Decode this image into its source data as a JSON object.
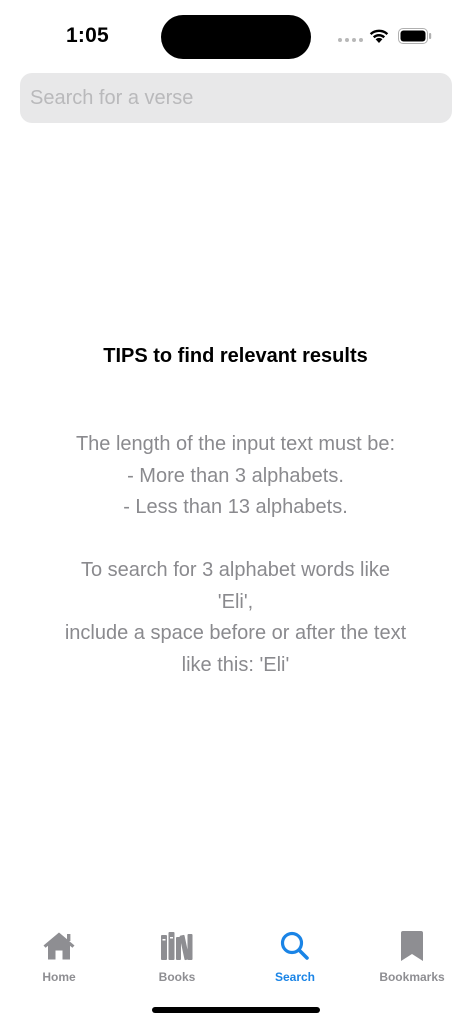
{
  "status_bar": {
    "time": "1:05"
  },
  "search": {
    "placeholder": "Search for a verse",
    "value": ""
  },
  "tips": {
    "title": "TIPS to find relevant results",
    "lines": [
      "The length of the input text must be:",
      "- More than 3 alphabets.",
      "- Less than 13 alphabets.",
      "To search for 3 alphabet words like",
      "'Eli',",
      "include a space before or after the text",
      "like this: 'Eli'"
    ]
  },
  "tab_bar": {
    "active_tab": "Search",
    "accent_color": "#1a84e6",
    "inactive_color": "#8e8e92",
    "tabs": [
      {
        "label": "Home",
        "icon": "home-icon"
      },
      {
        "label": "Books",
        "icon": "books-icon"
      },
      {
        "label": "Search",
        "icon": "search-icon"
      },
      {
        "label": "Bookmarks",
        "icon": "bookmark-icon"
      }
    ]
  }
}
